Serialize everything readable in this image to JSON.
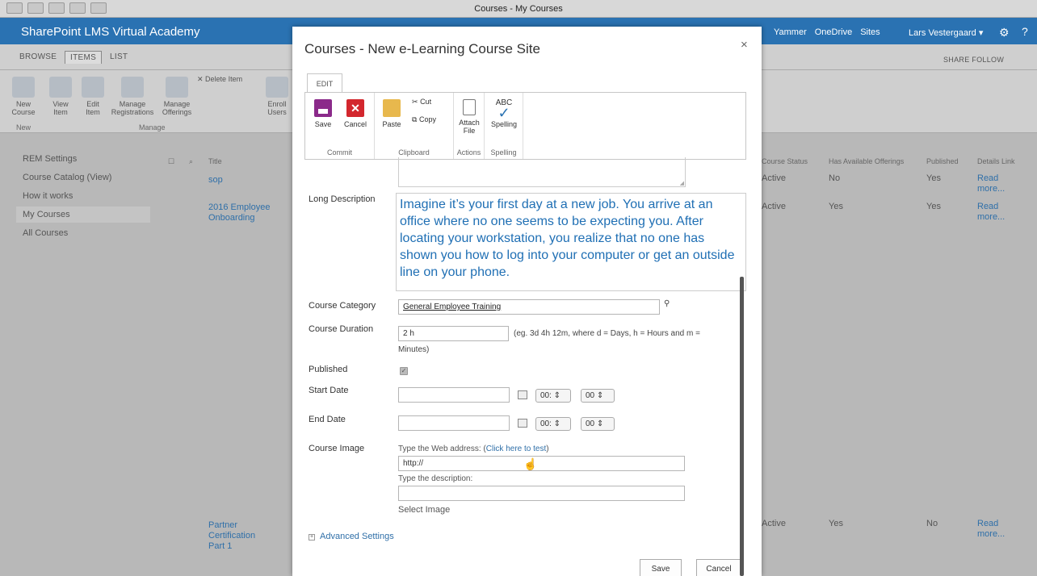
{
  "window": {
    "title": "Courses - My Courses"
  },
  "suitebar": {
    "brand": "SharePoint LMS Virtual Academy",
    "links": [
      "Yammer",
      "OneDrive",
      "Sites"
    ],
    "user": "Lars Vestergaard ▾"
  },
  "ribbon_tabs": [
    "BROWSE",
    "ITEMS",
    "LIST"
  ],
  "share_follow": "SHARE  FOLLOW",
  "bg_ribbon": {
    "buttons": [
      {
        "label": "New Course"
      },
      {
        "label": "View Item"
      },
      {
        "label": "Edit Item"
      },
      {
        "label": "Manage Registrations"
      },
      {
        "label": "Manage Offerings"
      }
    ],
    "delete_item": "Delete Item",
    "enroll_users": "Enroll Users",
    "groups": [
      "New",
      "Manage"
    ]
  },
  "left_nav": [
    "REM Settings",
    "Course Catalog (View)",
    "How it works",
    "My Courses",
    "All Courses"
  ],
  "bg_list": {
    "title_header": "Title",
    "columns": [
      "Course Status",
      "Has Available Offerings",
      "Published",
      "Details Link"
    ],
    "rows": [
      {
        "title": "sop",
        "status": "Active",
        "offerings": "No",
        "published": "Yes",
        "details": "Read more..."
      },
      {
        "title": "2016 Employee Onboarding",
        "status": "Active",
        "offerings": "Yes",
        "published": "Yes",
        "details": "Read more..."
      },
      {
        "title": "Partner Certification Part 1",
        "status": "Active",
        "offerings": "Yes",
        "published": "No",
        "details": "Read more..."
      }
    ]
  },
  "dialog": {
    "title": "Courses - New e-Learning Course Site",
    "close": "×",
    "edit_tab": "EDIT",
    "ribbon": {
      "save": "Save",
      "cancel": "Cancel",
      "commit": "Commit",
      "paste": "Paste",
      "cut": "Cut",
      "copy": "Copy",
      "clipboard": "Clipboard",
      "attach_file": "Attach File",
      "actions": "Actions",
      "spelling_btn": "Spelling",
      "spelling_abc": "ABC",
      "spelling_group": "Spelling"
    },
    "long_description_label": "Long Description",
    "long_description": "Imagine it’s your first day at a new job. You arrive at an office where no one seems to be expecting you. After locating your workstation, you realize that no one has shown you how to log into your computer or get an outside line on your phone.",
    "course_category_label": "Course Category",
    "course_category_value": "General Employee Training",
    "course_duration_label": "Course Duration",
    "course_duration_value": "2 h",
    "course_duration_hint": "(eg. 3d 4h 12m, where d = Days, h = Hours and m =",
    "course_duration_hint2": "Minutes)",
    "published_label": "Published",
    "start_date_label": "Start Date",
    "end_date_label": "End Date",
    "hour_value": "00:",
    "minute_value": "00",
    "course_image_label": "Course Image",
    "web_address_prompt": "Type the Web address: (",
    "click_to_test": "Click here to test",
    "web_address_close": ")",
    "url_value": "http://",
    "description_prompt": "Type the description:",
    "select_image": "Select Image",
    "advanced_settings": "Advanced Settings",
    "save_button": "Save",
    "cancel_button": "Cancel"
  }
}
